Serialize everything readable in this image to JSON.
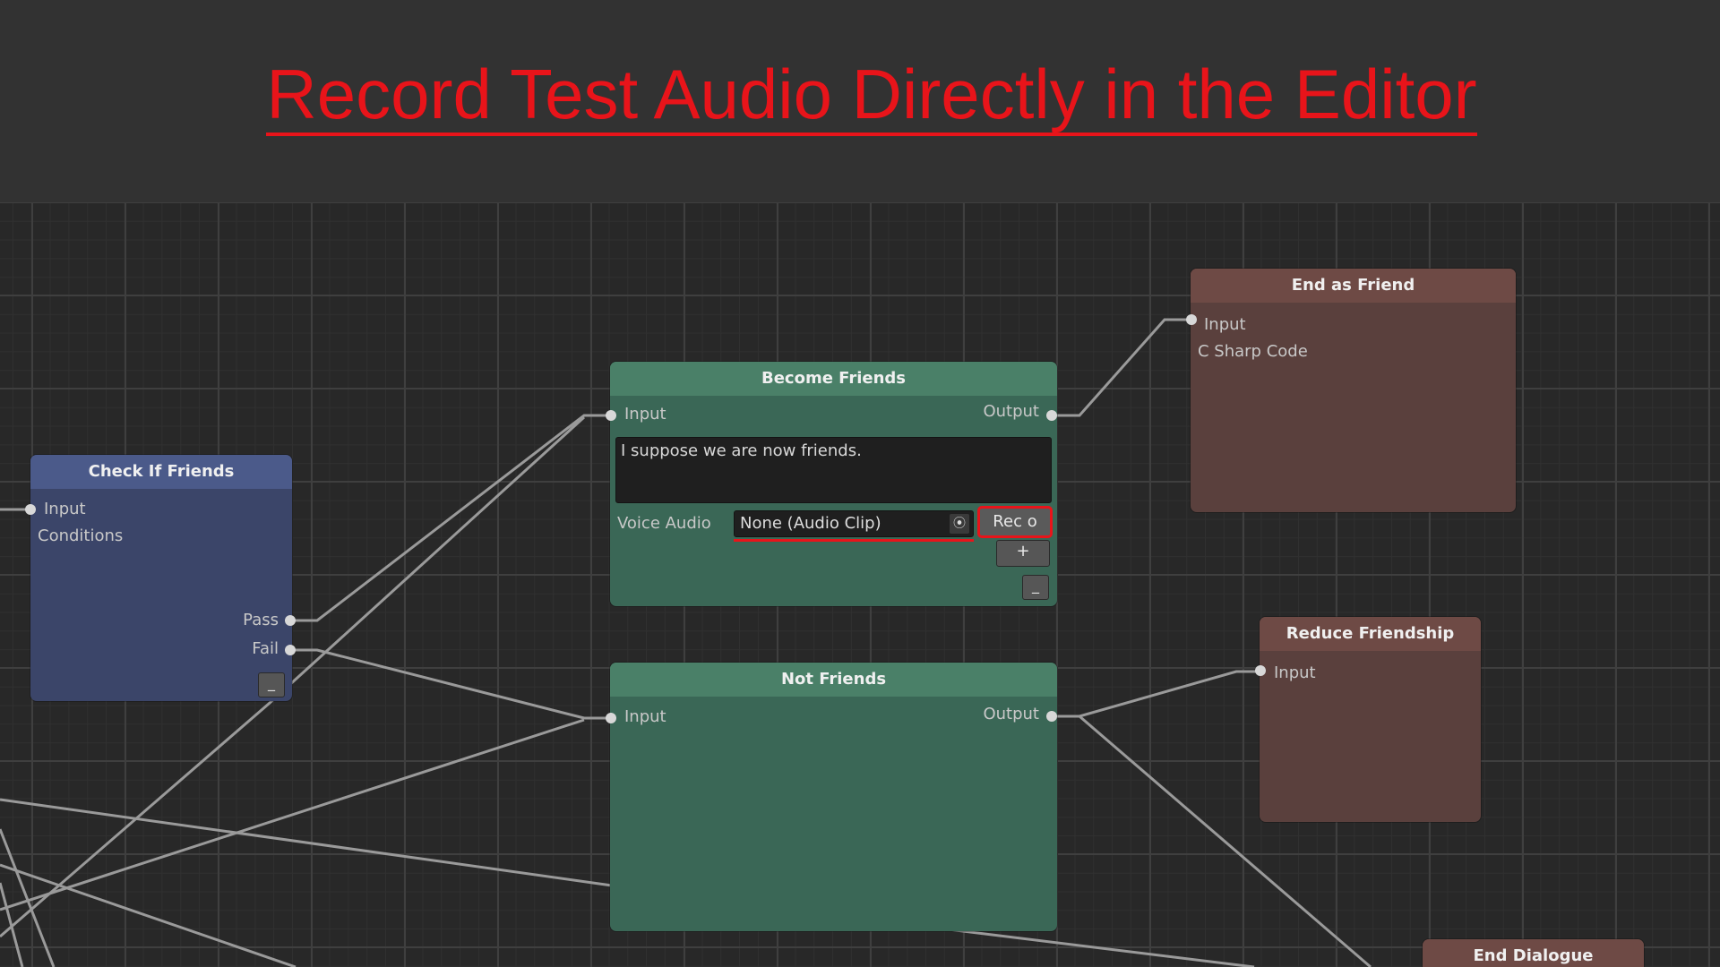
{
  "slide": {
    "title": "Record Test Audio Directly in the Editor",
    "accent_color": "#e8141a"
  },
  "nodes": {
    "check_if_friends": {
      "title": "Check If Friends",
      "input_label": "Input",
      "conditions_label": "Conditions",
      "pass_label": "Pass",
      "fail_label": "Fail",
      "collapse_label": "_",
      "color": "#4b5a8a"
    },
    "become_friends": {
      "title": "Become Friends",
      "input_label": "Input",
      "output_label": "Output",
      "dialogue_text": "I suppose we are now friends.",
      "voice_audio_label": "Voice Audio",
      "audio_clip_value": "None (Audio Clip)",
      "record_label": "Rec o",
      "add_label": "+",
      "collapse_label": "_",
      "color": "#4a8068"
    },
    "not_friends": {
      "title": "Not Friends",
      "input_label": "Input",
      "output_label": "Output",
      "color": "#4a8068"
    },
    "end_as_friend": {
      "title": "End as Friend",
      "input_label": "Input",
      "code_label": "C Sharp Code",
      "color": "#6e4a45"
    },
    "reduce_friendship": {
      "title": "Reduce Friendship",
      "input_label": "Input",
      "color": "#6e4a45"
    },
    "end_dialogue": {
      "title": "End Dialogue",
      "color": "#6e4a45"
    }
  },
  "icons": {
    "object_picker": "target-icon"
  }
}
